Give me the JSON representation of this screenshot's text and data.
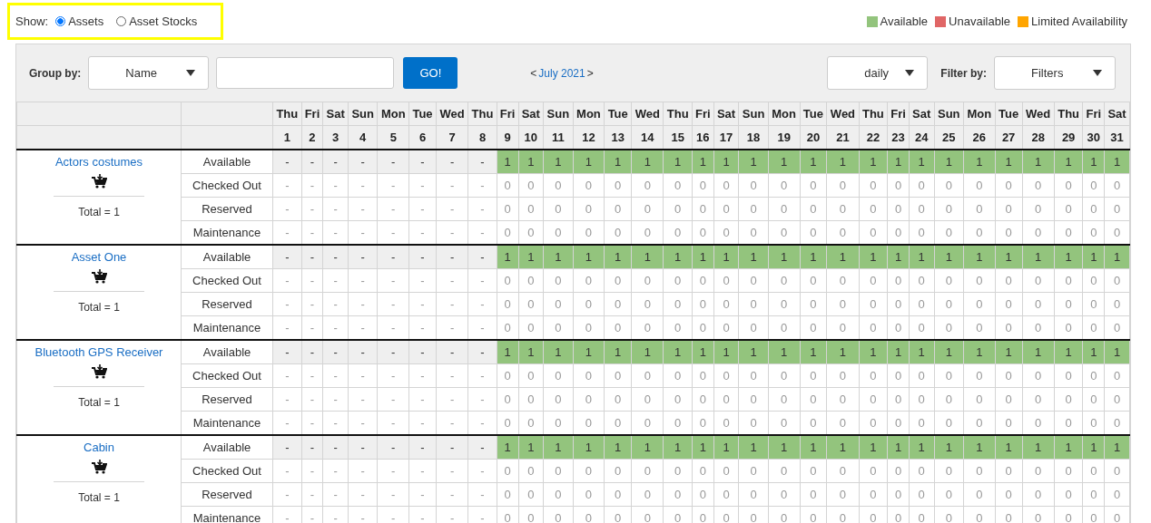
{
  "show": {
    "label": "Show:",
    "options": [
      {
        "label": "Assets",
        "selected": true
      },
      {
        "label": "Asset Stocks",
        "selected": false
      }
    ]
  },
  "legend": [
    {
      "label": "Available",
      "color": "#93c47d"
    },
    {
      "label": "Unavailable",
      "color": "#e06666"
    },
    {
      "label": "Limited Availability",
      "color": "#ffa500"
    }
  ],
  "toolbar": {
    "group_by_label": "Group by:",
    "group_by_value": "Name",
    "go_button": "GO!",
    "prev": "<",
    "month": "July 2021",
    "next": ">",
    "period": "daily",
    "filter_label": "Filter by:",
    "filter_value": "Filters"
  },
  "days": [
    {
      "dow": "Thu",
      "day": "1"
    },
    {
      "dow": "Fri",
      "day": "2"
    },
    {
      "dow": "Sat",
      "day": "3"
    },
    {
      "dow": "Sun",
      "day": "4"
    },
    {
      "dow": "Mon",
      "day": "5"
    },
    {
      "dow": "Tue",
      "day": "6"
    },
    {
      "dow": "Wed",
      "day": "7"
    },
    {
      "dow": "Thu",
      "day": "8"
    },
    {
      "dow": "Fri",
      "day": "9"
    },
    {
      "dow": "Sat",
      "day": "10"
    },
    {
      "dow": "Sun",
      "day": "11"
    },
    {
      "dow": "Mon",
      "day": "12"
    },
    {
      "dow": "Tue",
      "day": "13"
    },
    {
      "dow": "Wed",
      "day": "14"
    },
    {
      "dow": "Thu",
      "day": "15"
    },
    {
      "dow": "Fri",
      "day": "16"
    },
    {
      "dow": "Sat",
      "day": "17"
    },
    {
      "dow": "Sun",
      "day": "18"
    },
    {
      "dow": "Mon",
      "day": "19"
    },
    {
      "dow": "Tue",
      "day": "20"
    },
    {
      "dow": "Wed",
      "day": "21"
    },
    {
      "dow": "Thu",
      "day": "22"
    },
    {
      "dow": "Fri",
      "day": "23"
    },
    {
      "dow": "Sat",
      "day": "24"
    },
    {
      "dow": "Sun",
      "day": "25"
    },
    {
      "dow": "Mon",
      "day": "26"
    },
    {
      "dow": "Tue",
      "day": "27"
    },
    {
      "dow": "Wed",
      "day": "28"
    },
    {
      "dow": "Thu",
      "day": "29"
    },
    {
      "dow": "Fri",
      "day": "30"
    },
    {
      "dow": "Sat",
      "day": "31"
    }
  ],
  "assets": [
    {
      "name": "Actors costumes",
      "total": "Total = 1",
      "rows": [
        {
          "label": "Available",
          "kind": "availability",
          "cells": [
            "-",
            "-",
            "-",
            "-",
            "-",
            "-",
            "-",
            "-",
            "1",
            "1",
            "1",
            "1",
            "1",
            "1",
            "1",
            "1",
            "1",
            "1",
            "1",
            "1",
            "1",
            "1",
            "1",
            "1",
            "1",
            "1",
            "1",
            "1",
            "1",
            "1",
            "1"
          ],
          "available": [
            false,
            false,
            false,
            false,
            false,
            false,
            false,
            false,
            true,
            true,
            true,
            true,
            true,
            true,
            true,
            true,
            true,
            true,
            true,
            true,
            true,
            true,
            true,
            true,
            true,
            true,
            true,
            true,
            true,
            true,
            true
          ]
        },
        {
          "label": "Checked Out",
          "kind": "count",
          "cells": [
            "-",
            "-",
            "-",
            "-",
            "-",
            "-",
            "-",
            "-",
            "0",
            "0",
            "0",
            "0",
            "0",
            "0",
            "0",
            "0",
            "0",
            "0",
            "0",
            "0",
            "0",
            "0",
            "0",
            "0",
            "0",
            "0",
            "0",
            "0",
            "0",
            "0",
            "0"
          ]
        },
        {
          "label": "Reserved",
          "kind": "count",
          "cells": [
            "-",
            "-",
            "-",
            "-",
            "-",
            "-",
            "-",
            "-",
            "0",
            "0",
            "0",
            "0",
            "0",
            "0",
            "0",
            "0",
            "0",
            "0",
            "0",
            "0",
            "0",
            "0",
            "0",
            "0",
            "0",
            "0",
            "0",
            "0",
            "0",
            "0",
            "0"
          ]
        },
        {
          "label": "Maintenance",
          "kind": "count",
          "cells": [
            "-",
            "-",
            "-",
            "-",
            "-",
            "-",
            "-",
            "-",
            "0",
            "0",
            "0",
            "0",
            "0",
            "0",
            "0",
            "0",
            "0",
            "0",
            "0",
            "0",
            "0",
            "0",
            "0",
            "0",
            "0",
            "0",
            "0",
            "0",
            "0",
            "0",
            "0"
          ]
        }
      ]
    },
    {
      "name": "Asset One",
      "total": "Total = 1",
      "rows": [
        {
          "label": "Available",
          "kind": "availability",
          "cells": [
            "-",
            "-",
            "-",
            "-",
            "-",
            "-",
            "-",
            "-",
            "1",
            "1",
            "1",
            "1",
            "1",
            "1",
            "1",
            "1",
            "1",
            "1",
            "1",
            "1",
            "1",
            "1",
            "1",
            "1",
            "1",
            "1",
            "1",
            "1",
            "1",
            "1",
            "1"
          ],
          "available": [
            false,
            false,
            false,
            false,
            false,
            false,
            false,
            false,
            true,
            true,
            true,
            true,
            true,
            true,
            true,
            true,
            true,
            true,
            true,
            true,
            true,
            true,
            true,
            true,
            true,
            true,
            true,
            true,
            true,
            true,
            true
          ]
        },
        {
          "label": "Checked Out",
          "kind": "count",
          "cells": [
            "-",
            "-",
            "-",
            "-",
            "-",
            "-",
            "-",
            "-",
            "0",
            "0",
            "0",
            "0",
            "0",
            "0",
            "0",
            "0",
            "0",
            "0",
            "0",
            "0",
            "0",
            "0",
            "0",
            "0",
            "0",
            "0",
            "0",
            "0",
            "0",
            "0",
            "0"
          ]
        },
        {
          "label": "Reserved",
          "kind": "count",
          "cells": [
            "-",
            "-",
            "-",
            "-",
            "-",
            "-",
            "-",
            "-",
            "0",
            "0",
            "0",
            "0",
            "0",
            "0",
            "0",
            "0",
            "0",
            "0",
            "0",
            "0",
            "0",
            "0",
            "0",
            "0",
            "0",
            "0",
            "0",
            "0",
            "0",
            "0",
            "0"
          ]
        },
        {
          "label": "Maintenance",
          "kind": "count",
          "cells": [
            "-",
            "-",
            "-",
            "-",
            "-",
            "-",
            "-",
            "-",
            "0",
            "0",
            "0",
            "0",
            "0",
            "0",
            "0",
            "0",
            "0",
            "0",
            "0",
            "0",
            "0",
            "0",
            "0",
            "0",
            "0",
            "0",
            "0",
            "0",
            "0",
            "0",
            "0"
          ]
        }
      ]
    },
    {
      "name": "Bluetooth GPS Receiver",
      "total": "Total = 1",
      "rows": [
        {
          "label": "Available",
          "kind": "availability",
          "cells": [
            "-",
            "-",
            "-",
            "-",
            "-",
            "-",
            "-",
            "-",
            "1",
            "1",
            "1",
            "1",
            "1",
            "1",
            "1",
            "1",
            "1",
            "1",
            "1",
            "1",
            "1",
            "1",
            "1",
            "1",
            "1",
            "1",
            "1",
            "1",
            "1",
            "1",
            "1"
          ],
          "available": [
            false,
            false,
            false,
            false,
            false,
            false,
            false,
            false,
            true,
            true,
            true,
            true,
            true,
            true,
            true,
            true,
            true,
            true,
            true,
            true,
            true,
            true,
            true,
            true,
            true,
            true,
            true,
            true,
            true,
            true,
            true
          ]
        },
        {
          "label": "Checked Out",
          "kind": "count",
          "cells": [
            "-",
            "-",
            "-",
            "-",
            "-",
            "-",
            "-",
            "-",
            "0",
            "0",
            "0",
            "0",
            "0",
            "0",
            "0",
            "0",
            "0",
            "0",
            "0",
            "0",
            "0",
            "0",
            "0",
            "0",
            "0",
            "0",
            "0",
            "0",
            "0",
            "0",
            "0"
          ]
        },
        {
          "label": "Reserved",
          "kind": "count",
          "cells": [
            "-",
            "-",
            "-",
            "-",
            "-",
            "-",
            "-",
            "-",
            "0",
            "0",
            "0",
            "0",
            "0",
            "0",
            "0",
            "0",
            "0",
            "0",
            "0",
            "0",
            "0",
            "0",
            "0",
            "0",
            "0",
            "0",
            "0",
            "0",
            "0",
            "0",
            "0"
          ]
        },
        {
          "label": "Maintenance",
          "kind": "count",
          "cells": [
            "-",
            "-",
            "-",
            "-",
            "-",
            "-",
            "-",
            "-",
            "0",
            "0",
            "0",
            "0",
            "0",
            "0",
            "0",
            "0",
            "0",
            "0",
            "0",
            "0",
            "0",
            "0",
            "0",
            "0",
            "0",
            "0",
            "0",
            "0",
            "0",
            "0",
            "0"
          ]
        }
      ]
    },
    {
      "name": "Cabin",
      "total": "Total = 1",
      "rows": [
        {
          "label": "Available",
          "kind": "availability",
          "cells": [
            "-",
            "-",
            "-",
            "-",
            "-",
            "-",
            "-",
            "-",
            "1",
            "1",
            "1",
            "1",
            "1",
            "1",
            "1",
            "1",
            "1",
            "1",
            "1",
            "1",
            "1",
            "1",
            "1",
            "1",
            "1",
            "1",
            "1",
            "1",
            "1",
            "1",
            "1"
          ],
          "available": [
            false,
            false,
            false,
            false,
            false,
            false,
            false,
            false,
            true,
            true,
            true,
            true,
            true,
            true,
            true,
            true,
            true,
            true,
            true,
            true,
            true,
            true,
            true,
            true,
            true,
            true,
            true,
            true,
            true,
            true,
            true
          ]
        },
        {
          "label": "Checked Out",
          "kind": "count",
          "cells": [
            "-",
            "-",
            "-",
            "-",
            "-",
            "-",
            "-",
            "-",
            "0",
            "0",
            "0",
            "0",
            "0",
            "0",
            "0",
            "0",
            "0",
            "0",
            "0",
            "0",
            "0",
            "0",
            "0",
            "0",
            "0",
            "0",
            "0",
            "0",
            "0",
            "0",
            "0"
          ]
        },
        {
          "label": "Reserved",
          "kind": "count",
          "cells": [
            "-",
            "-",
            "-",
            "-",
            "-",
            "-",
            "-",
            "-",
            "0",
            "0",
            "0",
            "0",
            "0",
            "0",
            "0",
            "0",
            "0",
            "0",
            "0",
            "0",
            "0",
            "0",
            "0",
            "0",
            "0",
            "0",
            "0",
            "0",
            "0",
            "0",
            "0"
          ]
        },
        {
          "label": "Maintenance",
          "kind": "count",
          "cells": [
            "-",
            "-",
            "-",
            "-",
            "-",
            "-",
            "-",
            "-",
            "0",
            "0",
            "0",
            "0",
            "0",
            "0",
            "0",
            "0",
            "0",
            "0",
            "0",
            "0",
            "0",
            "0",
            "0",
            "0",
            "0",
            "0",
            "0",
            "0",
            "0",
            "0",
            "0"
          ]
        }
      ]
    }
  ]
}
